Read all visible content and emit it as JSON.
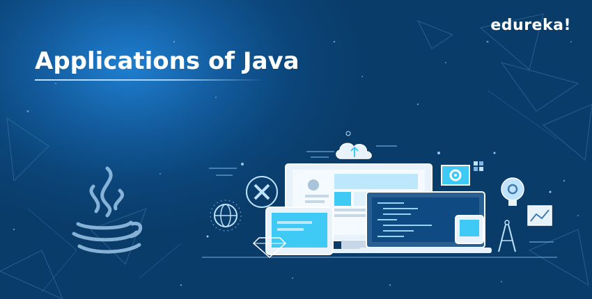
{
  "brand": {
    "name": "edureka!"
  },
  "banner": {
    "title": "Applications of Java"
  },
  "icons": {
    "java": "java-coffee-cup-logo",
    "cloud": "cloud-upload-icon",
    "gear": "gear-icon",
    "globe": "globe-icon",
    "close": "close-x-icon",
    "diamond": "diamond-icon",
    "bulb": "light-bulb-gear-icon",
    "chart": "line-chart-icon",
    "compass": "drafting-compass-icon"
  },
  "colors": {
    "background": "#0b4579",
    "accent_cyan": "#3fc9f5",
    "panel_light": "#e8f2fb",
    "text": "#ffffff"
  }
}
